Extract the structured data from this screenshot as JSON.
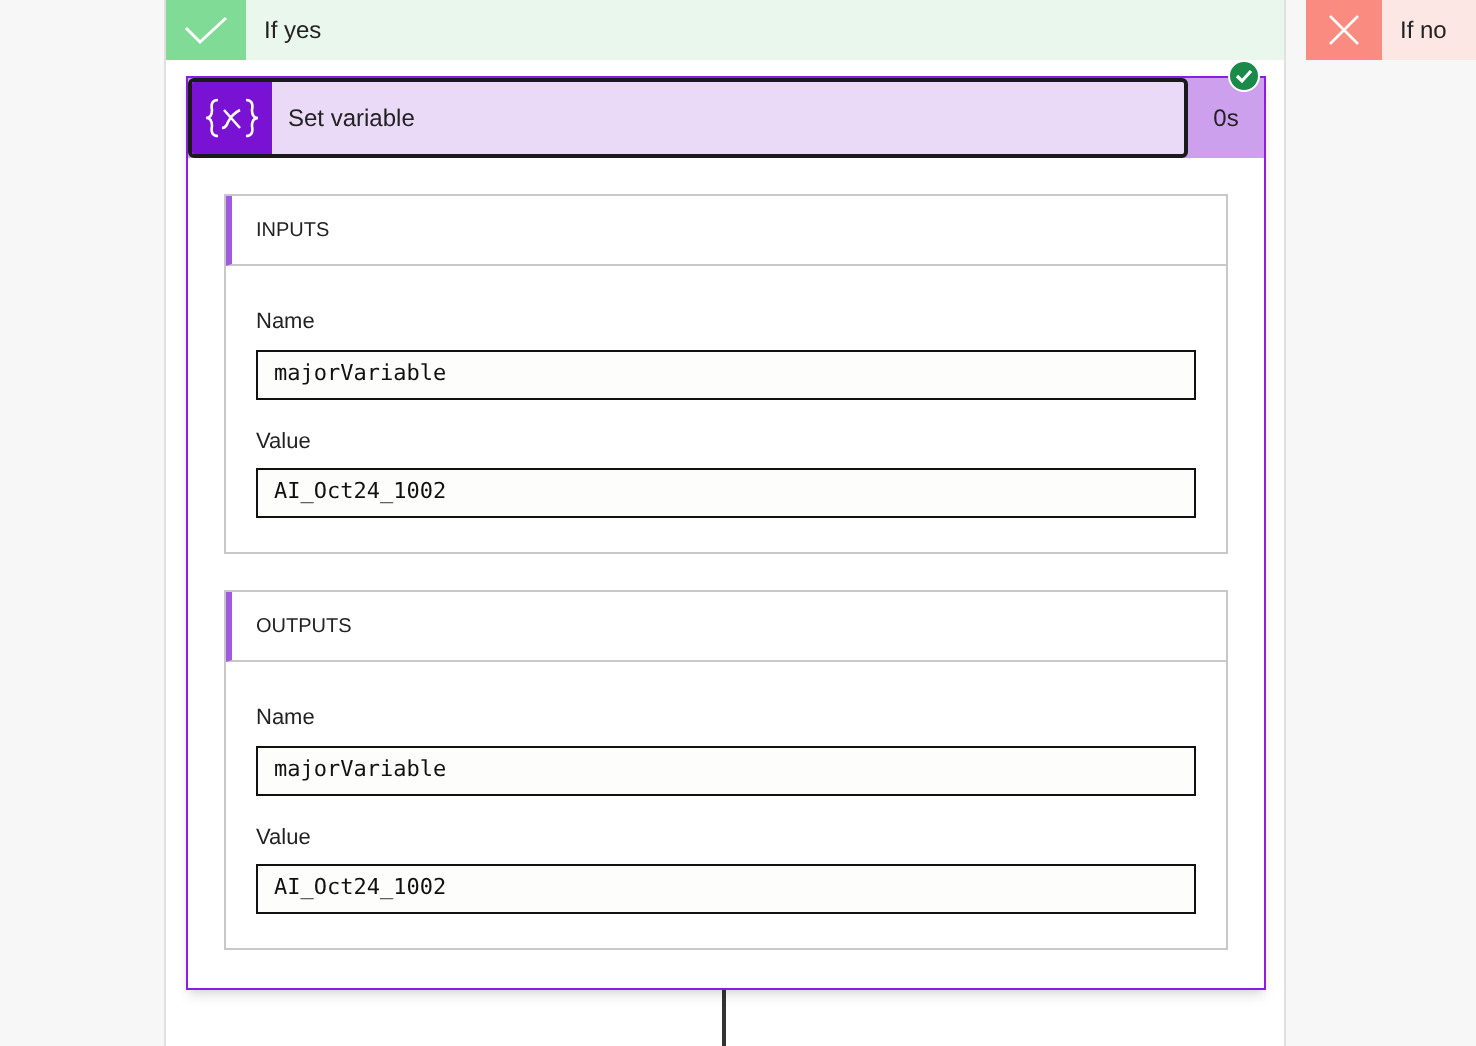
{
  "branches": [
    {
      "kind": "yes",
      "label": "If yes"
    },
    {
      "kind": "no",
      "label": "If no"
    }
  ],
  "action": {
    "title": "Set variable",
    "duration": "0s",
    "succeeded": true,
    "sections": [
      {
        "title": "INPUTS",
        "fields": [
          {
            "label": "Name",
            "value": "majorVariable"
          },
          {
            "label": "Value",
            "value": "AI_Oct24_1002"
          }
        ]
      },
      {
        "title": "OUTPUTS",
        "fields": [
          {
            "label": "Name",
            "value": "majorVariable"
          },
          {
            "label": "Value",
            "value": "AI_Oct24_1002"
          }
        ]
      }
    ]
  }
}
